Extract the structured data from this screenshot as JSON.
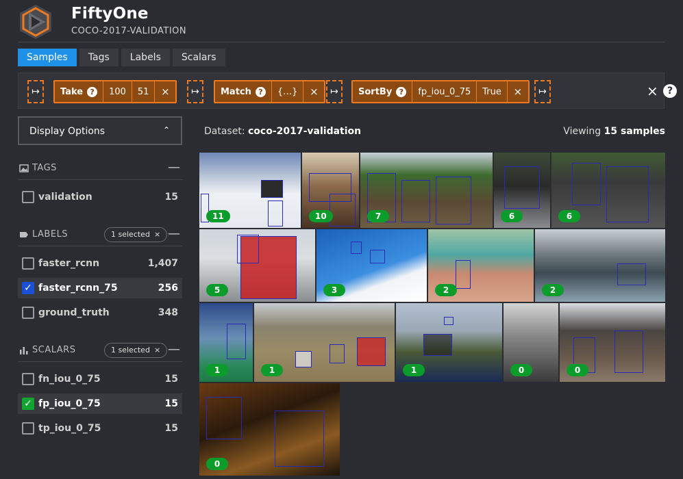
{
  "header": {
    "app_title": "FiftyOne",
    "dataset_title": "COCO-2017-VALIDATION"
  },
  "tabs": [
    {
      "label": "Samples",
      "active": true
    },
    {
      "label": "Tags",
      "active": false
    },
    {
      "label": "Labels",
      "active": false
    },
    {
      "label": "Scalars",
      "active": false
    }
  ],
  "view_bar": {
    "stages": [
      {
        "name": "Take",
        "params": [
          "100",
          "51"
        ]
      },
      {
        "name": "Match",
        "params": [
          "{…}"
        ]
      },
      {
        "name": "SortBy",
        "params": [
          "fp_iou_0_75",
          "True"
        ]
      }
    ],
    "arrow_glyph": "↦",
    "help_glyph": "?",
    "remove_glyph": "×"
  },
  "sidebar": {
    "display_options_label": "Display Options",
    "tags": {
      "title": "TAGS",
      "items": [
        {
          "name": "validation",
          "count": "15",
          "checked": false
        }
      ]
    },
    "labels": {
      "title": "LABELS",
      "pill": "1 selected",
      "items": [
        {
          "name": "faster_rcnn",
          "count": "1,407",
          "checked": false
        },
        {
          "name": "faster_rcnn_75",
          "count": "256",
          "checked": true
        },
        {
          "name": "ground_truth",
          "count": "348",
          "checked": false
        }
      ]
    },
    "scalars": {
      "title": "SCALARS",
      "pill": "1 selected",
      "items": [
        {
          "name": "fn_iou_0_75",
          "count": "15",
          "checked": false
        },
        {
          "name": "fp_iou_0_75",
          "count": "15",
          "checked": true
        },
        {
          "name": "tp_iou_0_75",
          "count": "15",
          "checked": false
        }
      ]
    }
  },
  "main": {
    "dataset_prefix": "Dataset:",
    "dataset_name": "coco-2017-validation",
    "viewing_prefix": "Viewing",
    "viewing_count": "15 samples"
  },
  "samples": [
    {
      "badge": "11",
      "scene": "ski slope with snowmobile"
    },
    {
      "badge": "10",
      "scene": "dining room"
    },
    {
      "badge": "7",
      "scene": "horses parade"
    },
    {
      "badge": "6",
      "scene": "motorcycles"
    },
    {
      "badge": "6",
      "scene": "police motorcycle"
    },
    {
      "badge": "5",
      "scene": "red double-decker bus"
    },
    {
      "badge": "3",
      "scene": "snowboard jump"
    },
    {
      "badge": "2",
      "scene": "beach crowd"
    },
    {
      "badge": "2",
      "scene": "harbor with mountains"
    },
    {
      "badge": "1",
      "scene": "tennis player"
    },
    {
      "badge": "1",
      "scene": "field with kites"
    },
    {
      "badge": "1",
      "scene": "cattle by lake"
    },
    {
      "badge": "0",
      "scene": "mountain black and white"
    },
    {
      "badge": "0",
      "scene": "market crowd"
    },
    {
      "badge": "0",
      "scene": "bar interior"
    }
  ],
  "colors": {
    "accent_blue": "#1e90e8",
    "stage_orange": "#f07a1e",
    "badge_green": "#0c9c2c",
    "checkbox_blue": "#1a4fd6",
    "checkbox_green": "#10a52e",
    "background": "#2b2c31"
  }
}
